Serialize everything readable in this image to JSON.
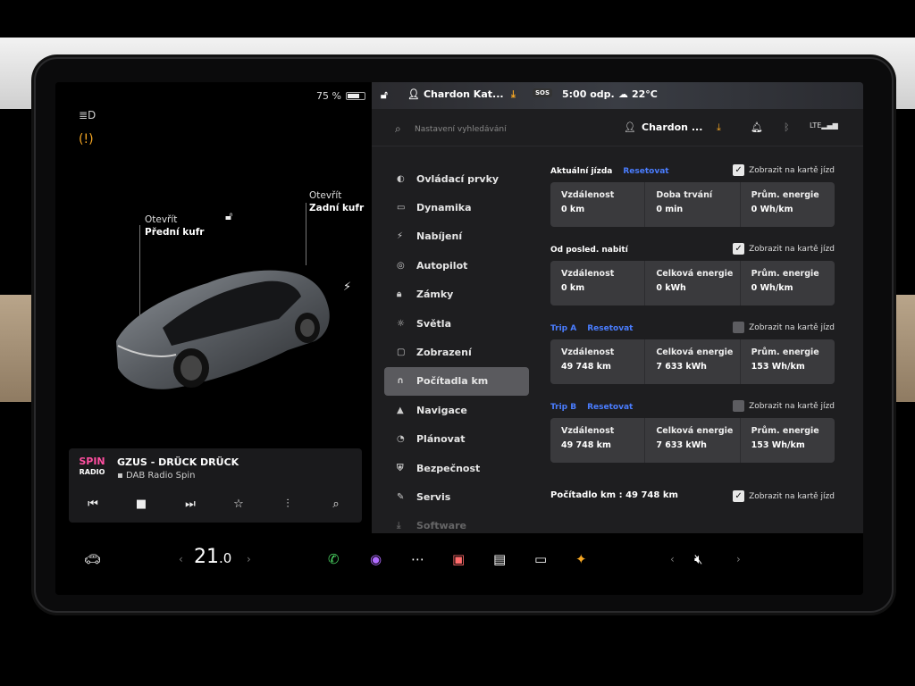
{
  "status": {
    "battery": "75 %",
    "battery_level": 0.75
  },
  "topbar": {
    "profile": "Chardon Kat...",
    "sos": "SOS",
    "time": "5:00 odp.",
    "weather": "22°C"
  },
  "car_labels": {
    "frunk_title": "Otevřít",
    "frunk_name": "Přední kufr",
    "trunk_title": "Otevřít",
    "trunk_name": "Zadní kufr"
  },
  "media": {
    "logo_top": "SPIN",
    "logo_bottom": "RADIO",
    "song": "GZUS - DRÜCK DRÜCK",
    "station": "DAB Radio Spin"
  },
  "search": {
    "placeholder": "Nastavení vyhledávání"
  },
  "profile_short": "Chardon ...",
  "nav": [
    {
      "icon": "toggle-icon",
      "label": "Ovládací prvky"
    },
    {
      "icon": "car-icon",
      "label": "Dynamika"
    },
    {
      "icon": "bolt-icon",
      "label": "Nabíjení"
    },
    {
      "icon": "steering-wheel-icon",
      "label": "Autopilot"
    },
    {
      "icon": "lock-icon",
      "label": "Zámky"
    },
    {
      "icon": "sun-icon",
      "label": "Světla"
    },
    {
      "icon": "display-icon",
      "label": "Zobrazení"
    },
    {
      "icon": "trip-icon",
      "label": "Počítadla km",
      "active": true
    },
    {
      "icon": "navigation-icon",
      "label": "Navigace"
    },
    {
      "icon": "alarm-icon",
      "label": "Plánovat"
    },
    {
      "icon": "shield-icon",
      "label": "Bezpečnost"
    },
    {
      "icon": "wrench-icon",
      "label": "Servis"
    },
    {
      "icon": "download-icon",
      "label": "Software"
    }
  ],
  "sections": [
    {
      "title": "Aktuální jízda",
      "reset": "Resetovat",
      "show_label": "Zobrazit na kartě jízd",
      "checked": true,
      "stats": [
        {
          "label": "Vzdálenost",
          "value": "0 km"
        },
        {
          "label": "Doba trvání",
          "value": "0 min"
        },
        {
          "label": "Prům. energie",
          "value": "0 Wh/km"
        }
      ]
    },
    {
      "title": "Od posled. nabití",
      "reset": "",
      "show_label": "Zobrazit na kartě jízd",
      "checked": true,
      "stats": [
        {
          "label": "Vzdálenost",
          "value": "0 km"
        },
        {
          "label": "Celková energie",
          "value": "0 kWh"
        },
        {
          "label": "Prům. energie",
          "value": "0 Wh/km"
        }
      ]
    },
    {
      "title": "Trip A",
      "reset": "Resetovat",
      "show_label": "Zobrazit na kartě jízd",
      "checked": false,
      "stats": [
        {
          "label": "Vzdálenost",
          "value": "49 748 km"
        },
        {
          "label": "Celková energie",
          "value": "7 633 kWh"
        },
        {
          "label": "Prům. energie",
          "value": "153 Wh/km"
        }
      ]
    },
    {
      "title": "Trip B",
      "reset": "Resetovat",
      "show_label": "Zobrazit na kartě jízd",
      "checked": false,
      "stats": [
        {
          "label": "Vzdálenost",
          "value": "49 748 km"
        },
        {
          "label": "Celková energie",
          "value": "7 633 kWh"
        },
        {
          "label": "Prům. energie",
          "value": "153 Wh/km"
        }
      ]
    }
  ],
  "odometer": {
    "label": "Počítadlo km :",
    "value": "49 748 km",
    "show_label": "Zobrazit na kartě jízd",
    "checked": true
  },
  "dock": {
    "temp_int": "21",
    "temp_dec": ".0"
  },
  "colors": {
    "accent": "#4a7dff",
    "warning": "#f5a623",
    "download": "#f5a623"
  }
}
